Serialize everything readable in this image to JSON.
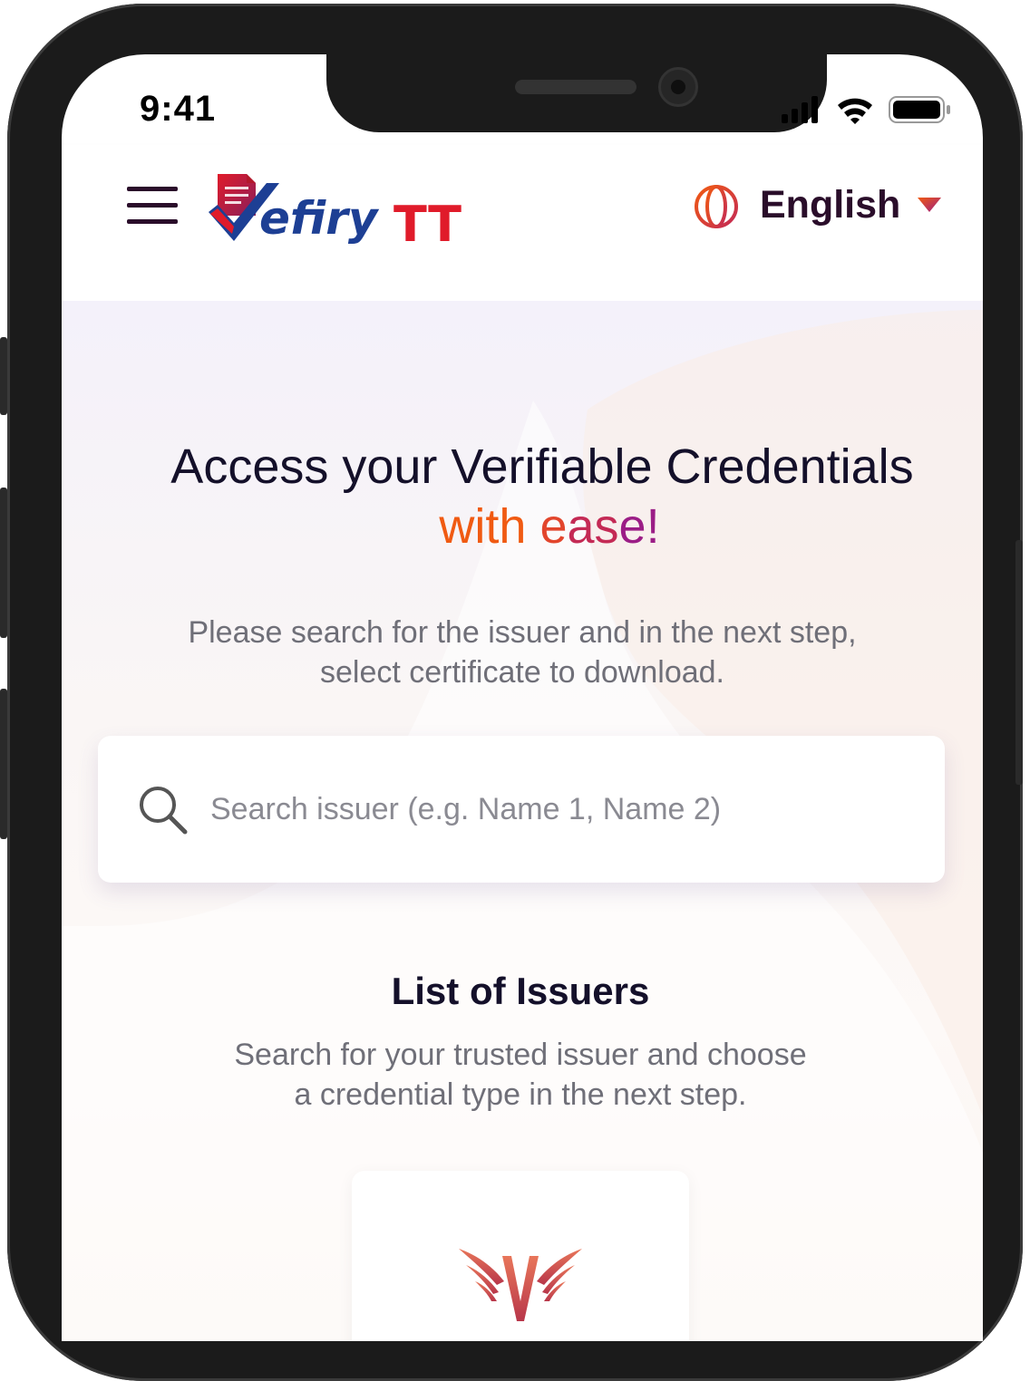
{
  "status_bar": {
    "time": "9:41",
    "icons": [
      "cellular-signal-icon",
      "wifi-icon",
      "battery-icon"
    ]
  },
  "header": {
    "menu_icon": "hamburger-menu-icon",
    "logo_text_main": "efiry",
    "logo_text_suffix": "TT",
    "language": {
      "icon": "globe-icon",
      "selected": "English",
      "caret": "caret-down-icon"
    }
  },
  "hero": {
    "title": "Access your Verifiable Credentials",
    "accent_words": [
      "with",
      "e",
      "as",
      "e!"
    ],
    "description_line1": "Please search for the issuer and in the next step,",
    "description_line2": "select certificate to download."
  },
  "search": {
    "placeholder": "Search issuer (e.g. Name 1, Name 2)",
    "value": "",
    "icon": "search-icon"
  },
  "issuers": {
    "title": "List of Issuers",
    "description_line1": "Search for your trusted issuer and choose",
    "description_line2": "a credential type in the next step.",
    "cards": [
      {
        "logo_icon": "winged-v-logo-icon"
      }
    ]
  },
  "colors": {
    "brand_dark": "#2a0d2a",
    "text_dark": "#14102a",
    "accent_orange": "#f05a12",
    "accent_purple": "#9b1d86",
    "logo_red": "#e01b2a",
    "logo_blue": "#1d3f94"
  }
}
